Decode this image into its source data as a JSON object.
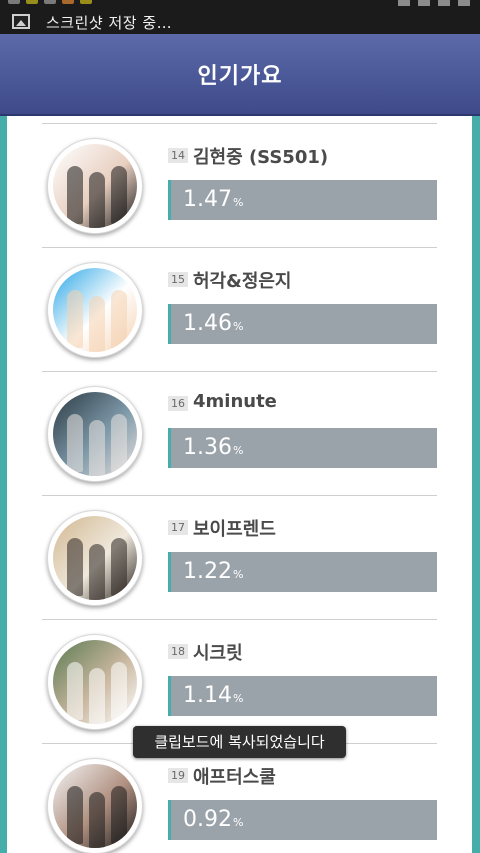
{
  "status_bar": {
    "notification_text": "스크린샷 저장 중…",
    "notification_icon": "screenshot-image-icon"
  },
  "header": {
    "title": "인기가요"
  },
  "rankings": [
    {
      "rank": "14",
      "artist": "김현중 (SS501)",
      "percent": "1.47",
      "unit": "%",
      "share": 1.47,
      "photo_colors": [
        "#ffffff",
        "#1a1a1a",
        "#e8cfc0"
      ]
    },
    {
      "rank": "15",
      "artist": "허각&정은지",
      "percent": "1.46",
      "unit": "%",
      "share": 1.46,
      "photo_colors": [
        "#2aa6e6",
        "#f4d1b0",
        "#ffffff"
      ]
    },
    {
      "rank": "16",
      "artist": "4minute",
      "percent": "1.36",
      "unit": "%",
      "share": 1.36,
      "photo_colors": [
        "#2b3a44",
        "#e9e3e0",
        "#7d98a8"
      ]
    },
    {
      "rank": "17",
      "artist": "보이프렌드",
      "percent": "1.22",
      "unit": "%",
      "share": 1.22,
      "photo_colors": [
        "#d2b891",
        "#2b2520",
        "#efe8dc"
      ]
    },
    {
      "rank": "18",
      "artist": "시크릿",
      "percent": "1.14",
      "unit": "%",
      "share": 1.14,
      "photo_colors": [
        "#5b7a52",
        "#ffffff",
        "#c9b79f"
      ]
    },
    {
      "rank": "19",
      "artist": "애프터스쿨",
      "percent": "0.92",
      "unit": "%",
      "share": 0.92,
      "photo_colors": [
        "#f4f4f4",
        "#1c1c1c",
        "#b09080"
      ]
    }
  ],
  "toast": {
    "text": "클립보드에 복사되었습니다"
  },
  "colors": {
    "header": "#4e5b9c",
    "frame": "#46aeaa",
    "bar": "#9aa2aa"
  }
}
